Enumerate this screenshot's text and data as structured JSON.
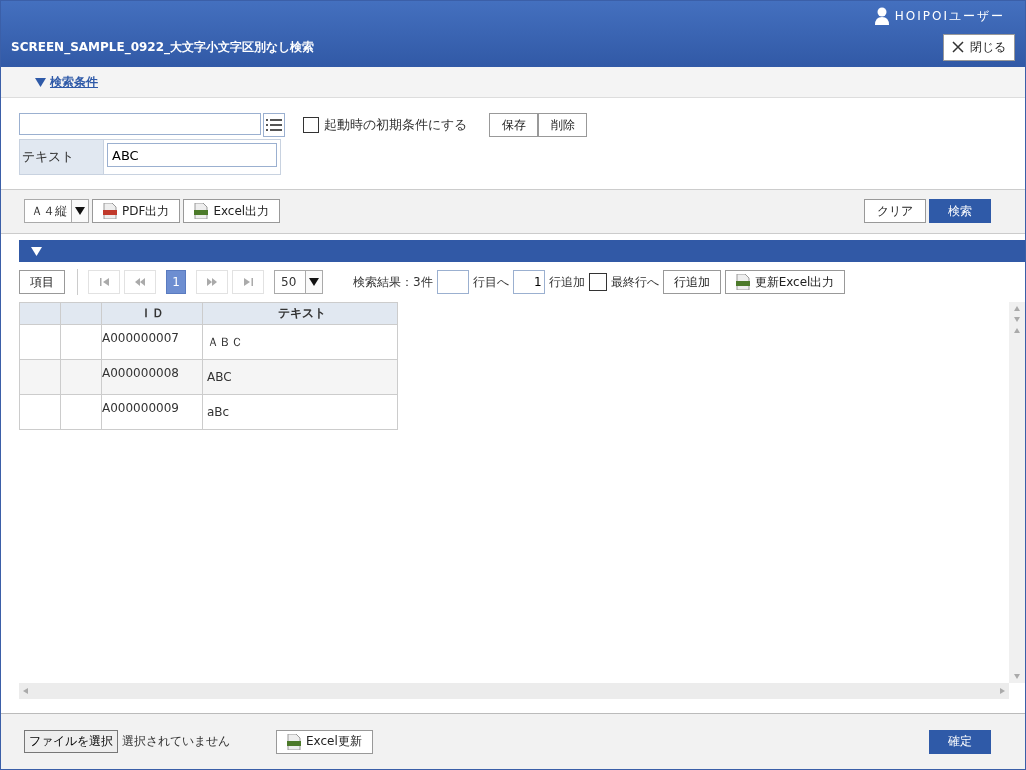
{
  "user": "HOIPOIユーザー",
  "title": "SCREEN_SAMPLE_0922_大文字小文字区別なし検索",
  "close_button": "閉じる",
  "conditions_toggle": {
    "label": "検索条件",
    "expanded": true
  },
  "default_checkbox": {
    "label": "起動時の初期条件にする",
    "checked": false
  },
  "save_button": "保存",
  "delete_button": "削除",
  "fields": [
    {
      "label": "テキスト",
      "value": "ABC"
    }
  ],
  "paper_select": "Ａ４縦",
  "pdf_button": "PDF出力",
  "excel_button": "Excel出力",
  "clear_button": "クリア",
  "search_button": "検索",
  "results_panel": {
    "expanded": true
  },
  "grid_toolbar": {
    "columns_button": "項目",
    "pages": [
      {
        "label": "1",
        "selected": true
      }
    ],
    "page_size": "50",
    "result_count": "検索結果：3件",
    "goto_label": "行目へ",
    "add_count": "1",
    "add_label": "行追加",
    "last_row": {
      "label": "最終行へ",
      "checked": false
    },
    "add_row_button": "行追加",
    "excel_export_button": "更新Excel出力"
  },
  "table": {
    "columns": [
      {
        "label": "ＩＤ"
      },
      {
        "label": "テキスト"
      }
    ],
    "rows": [
      {
        "id": "A000000007",
        "text": "ＡＢＣ"
      },
      {
        "id": "A000000008",
        "text": "ABC"
      },
      {
        "id": "A000000009",
        "text": "aBc"
      }
    ]
  },
  "footer": {
    "file_button": "ファイルを選択",
    "file_status": "選択されていません",
    "excel_update_button": "Excel更新",
    "confirm_button": "確定"
  }
}
